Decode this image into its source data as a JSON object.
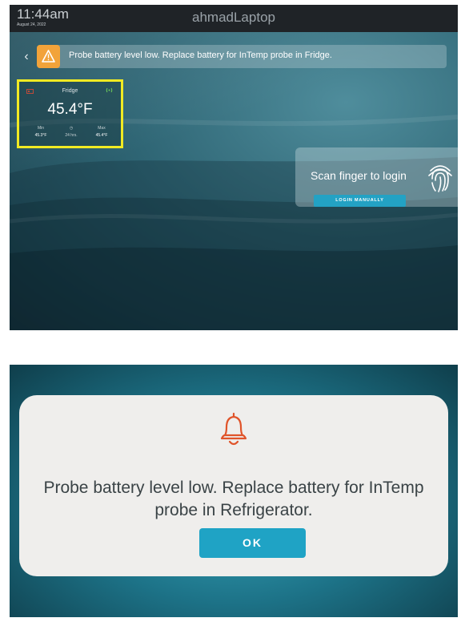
{
  "screen1": {
    "time": "11:44am",
    "date": "August 24, 2022",
    "device_name": "ahmadLaptop",
    "alert": {
      "icon": "warning-icon",
      "message": "Probe battery level low. Replace battery for InTemp probe in Fridge.",
      "accent_color": "#f2a33a"
    },
    "probe": {
      "name": "Fridge",
      "temperature": "45.4°F",
      "min_label": "Min",
      "min_value": "45.3°F",
      "period_label": "24 hrs.",
      "max_label": "Max",
      "max_value": "45.4°F",
      "highlight_color": "#f1ea23"
    },
    "login": {
      "prompt": "Scan finger to login",
      "button_label": "LOGIN MANUALLY"
    }
  },
  "screen2": {
    "message": "Probe battery level low. Replace battery for InTemp probe in Refrigerator.",
    "ok_label": "OK",
    "icon": "bell-icon",
    "bell_color": "#e0542a",
    "button_color": "#1fa3c5"
  }
}
